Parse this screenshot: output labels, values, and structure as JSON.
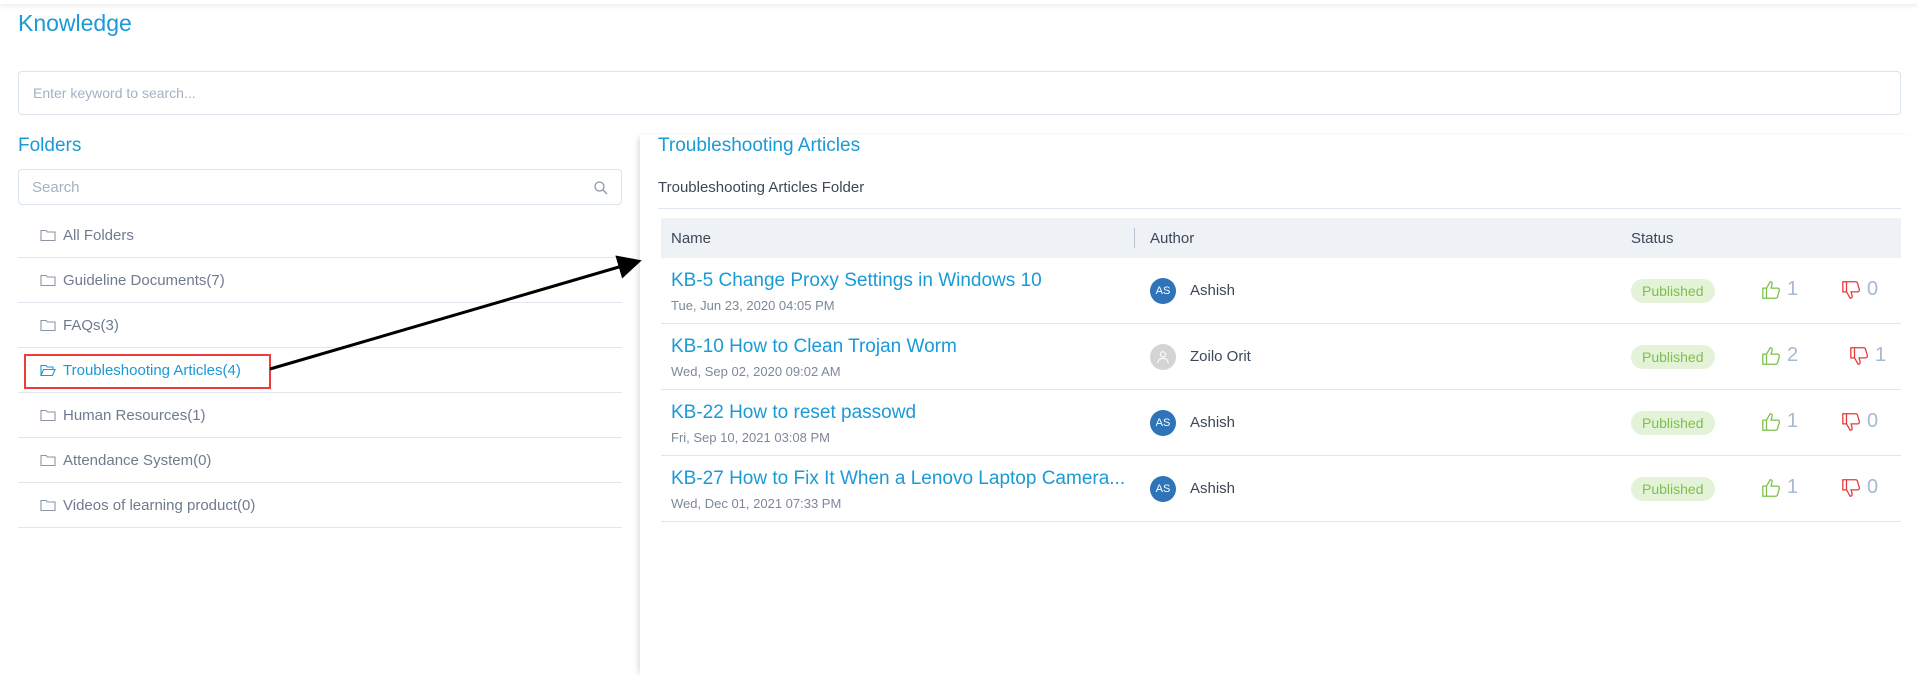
{
  "page": {
    "title": "Knowledge"
  },
  "keyword_search": {
    "placeholder": "Enter keyword to search..."
  },
  "folders": {
    "title": "Folders",
    "search_placeholder": "Search",
    "items": [
      {
        "label": "All Folders",
        "active": false
      },
      {
        "label": "Guideline Documents(7)",
        "active": false
      },
      {
        "label": "FAQs(3)",
        "active": false
      },
      {
        "label": "Troubleshooting Articles(4)",
        "active": true
      },
      {
        "label": "Human Resources(1)",
        "active": false
      },
      {
        "label": "Attendance System(0)",
        "active": false
      },
      {
        "label": "Videos of learning product(0)",
        "active": false
      }
    ]
  },
  "articles": {
    "title": "Troubleshooting Articles",
    "subtitle": "Troubleshooting Articles Folder",
    "columns": {
      "name": "Name",
      "author": "Author",
      "status": "Status"
    },
    "rows": [
      {
        "title": "KB-5 Change Proxy Settings in Windows 10",
        "date": "Tue, Jun 23, 2020 04:05 PM",
        "author_initials": "AS",
        "author": "Ashish",
        "status": "Published",
        "likes": "1",
        "dislikes": "0"
      },
      {
        "title": "KB-10 How to Clean Trojan Worm",
        "date": "Wed, Sep 02, 2020 09:02 AM",
        "author_initials": "",
        "author": "Zoilo Orit",
        "status": "Published",
        "likes": "2",
        "dislikes": "1"
      },
      {
        "title": "KB-22 How to reset passowd",
        "date": "Fri, Sep 10, 2021 03:08 PM",
        "author_initials": "AS",
        "author": "Ashish",
        "status": "Published",
        "likes": "1",
        "dislikes": "0"
      },
      {
        "title": "KB-27 How to Fix It When a Lenovo Laptop Camera...",
        "date": "Wed, Dec 01, 2021 07:33 PM",
        "author_initials": "AS",
        "author": "Ashish",
        "status": "Published",
        "likes": "1",
        "dislikes": "0"
      }
    ]
  },
  "colors": {
    "accent": "#1a9ad6",
    "published_bg": "#e4f3d8",
    "published_text": "#7cc04b",
    "like": "#7cc04b",
    "dislike": "#e53935",
    "highlight": "#ee3b3b"
  }
}
